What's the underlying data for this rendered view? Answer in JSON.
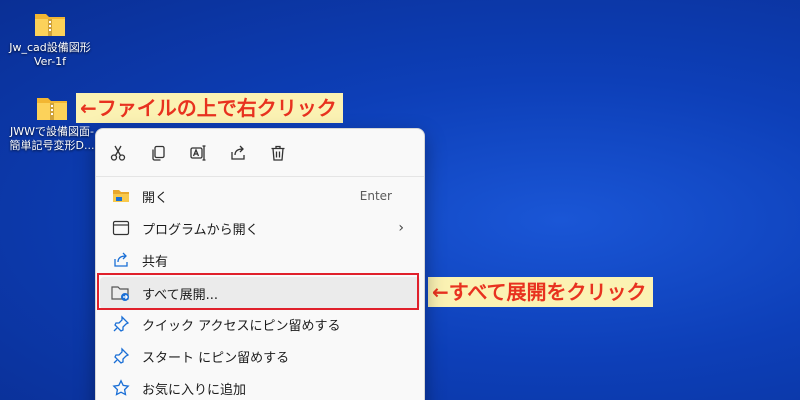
{
  "desktop": {
    "icons": [
      {
        "name": "Jw_cad設備図形\nVer-1f"
      },
      {
        "name": "JWWで設備図面-\n簡単記号変形D..."
      }
    ]
  },
  "annotations": {
    "right_click_file": "←ファイルの上で右クリック",
    "click_extract_all": "←すべて展開をクリック"
  },
  "context_menu": {
    "toolbar_icons": [
      "cut-icon",
      "copy-icon",
      "rename-icon",
      "share-icon",
      "delete-icon"
    ],
    "items": [
      {
        "label": "開く",
        "shortcut": "Enter",
        "icon": "folder-open-icon"
      },
      {
        "label": "プログラムから開く",
        "icon": "open-with-icon",
        "has_submenu": true
      },
      {
        "label": "共有",
        "icon": "share-icon"
      },
      {
        "label": "すべて展開...",
        "icon": "extract-all-icon",
        "highlighted": true
      },
      {
        "label": "クイック アクセスにピン留めする",
        "icon": "pin-icon"
      },
      {
        "label": "スタート にピン留めする",
        "icon": "pin-icon"
      },
      {
        "label": "お気に入りに追加",
        "icon": "star-icon"
      }
    ]
  },
  "colors": {
    "annotation_text": "#e8321f",
    "annotation_bg": "#fbf2b3",
    "highlight_border": "#e0202b",
    "accent": "#1a6fd6"
  }
}
